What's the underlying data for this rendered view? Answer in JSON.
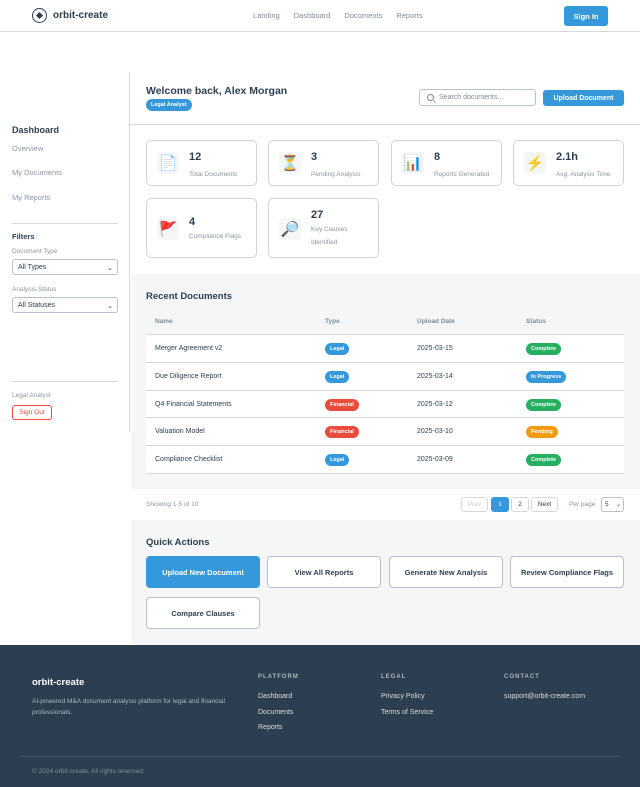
{
  "header": {
    "brand": "orbit-create",
    "nav": [
      "Landing",
      "Dashboard",
      "Documents",
      "Reports"
    ],
    "signin_label": "Sign In"
  },
  "sidebar": {
    "title": "Dashboard",
    "items": [
      "Overview",
      "My Documents",
      "My Reports"
    ],
    "filters_title": "Filters",
    "doc_type_label": "Document Type",
    "doc_type_value": "All Types",
    "status_label": "Analysis Status",
    "status_value": "All Statuses",
    "role": "Legal Analyst",
    "signout_label": "Sign Out"
  },
  "main": {
    "welcome": "Welcome back, Alex Morgan",
    "role_badge": "Legal Analyst",
    "search_placeholder": "Search documents...",
    "upload_label": "Upload Document"
  },
  "stats": [
    {
      "icon": "document-icon",
      "glyph": "📄",
      "value": "12",
      "label": "Total Documents"
    },
    {
      "icon": "hourglass-icon",
      "glyph": "⏳",
      "value": "3",
      "label": "Pending Analysis"
    },
    {
      "icon": "chart-icon",
      "glyph": "📊",
      "value": "8",
      "label": "Reports Generated"
    },
    {
      "icon": "lightning-icon",
      "glyph": "⚡",
      "value": "2.1h",
      "label": "Avg. Analysis Time"
    },
    {
      "icon": "flag-icon",
      "glyph": "🚩",
      "value": "4",
      "label": "Compliance Flags"
    },
    {
      "icon": "magnifier-icon",
      "glyph": "🔎",
      "value": "27",
      "label": "Key Clauses Identified"
    }
  ],
  "recent": {
    "title": "Recent Documents",
    "columns": [
      "Name",
      "Type",
      "Upload Date",
      "Status"
    ],
    "rows": [
      {
        "name": "Merger Agreement v2",
        "type": "Legal",
        "date": "2025-03-15",
        "status": "Complete"
      },
      {
        "name": "Due Diligence Report",
        "type": "Legal",
        "date": "2025-03-14",
        "status": "In Progress"
      },
      {
        "name": "Q4 Financial Statements",
        "type": "Financial",
        "date": "2025-03-12",
        "status": "Complete"
      },
      {
        "name": "Valuation Model",
        "type": "Financial",
        "date": "2025-03-10",
        "status": "Pending"
      },
      {
        "name": "Compliance Checklist",
        "type": "Legal",
        "date": "2025-03-09",
        "status": "Complete"
      }
    ]
  },
  "pagination": {
    "showing": "Showing 1-5 of 10",
    "prev": "Prev",
    "pages": [
      "1",
      "2"
    ],
    "next": "Next",
    "per_page_label": "Per page",
    "per_page_value": "5"
  },
  "quick_actions": {
    "title": "Quick Actions",
    "items": [
      "Upload New Document",
      "View All Reports",
      "Generate New Analysis",
      "Review Compliance Flags",
      "Compare Clauses"
    ]
  },
  "footer": {
    "brand": "orbit-create",
    "description": "AI-powered M&A document analysis platform for legal and financial professionals.",
    "platform_title": "PLATFORM",
    "platform_links": [
      "Dashboard",
      "Documents",
      "Reports"
    ],
    "legal_title": "LEGAL",
    "legal_links": [
      "Privacy Policy",
      "Terms of Service"
    ],
    "contact_title": "CONTACT",
    "contact_email": "support@orbit-create.com",
    "copyright": "© 2024 orbit-create. All rights reserved."
  },
  "colors": {
    "primary": "#3498db",
    "legal": "#3498db",
    "financial": "#e74c3c",
    "complete": "#27ae60",
    "in_progress": "#3498db",
    "pending": "#f39c12",
    "footer_bg": "#2c3e50"
  }
}
